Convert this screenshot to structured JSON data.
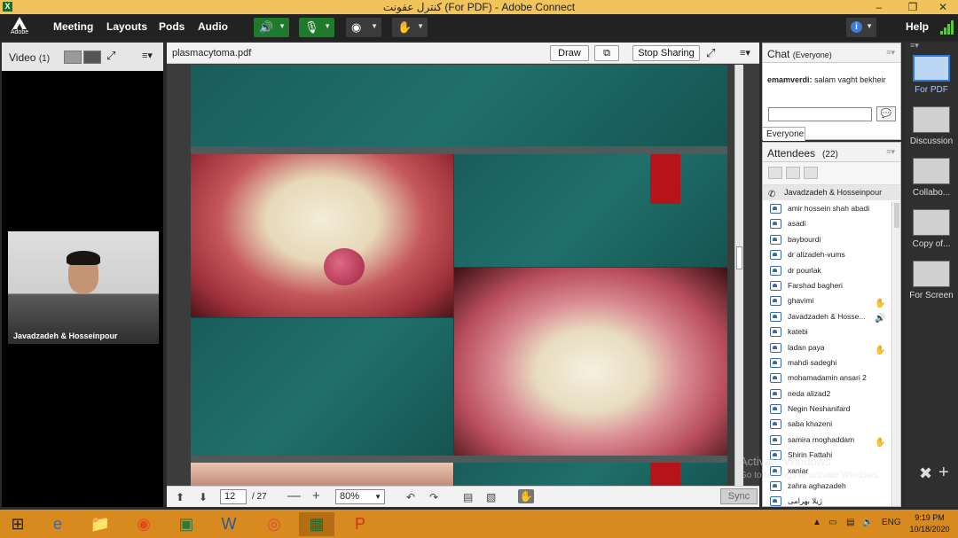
{
  "window": {
    "title": "کنترل عفونت (For PDF) - Adobe Connect",
    "logo_text": "Adobe"
  },
  "menubar": {
    "items": [
      "Meeting",
      "Layouts",
      "Pods",
      "Audio"
    ],
    "help_label": "Help",
    "speaker_state": "on",
    "mic_state": "muted"
  },
  "video_pod": {
    "title": "Video",
    "count": "(1)",
    "participant_name": "Javadzadeh & Hosseinpour"
  },
  "share_pod": {
    "filename": "plasmacytoma.pdf",
    "draw_label": "Draw",
    "stop_sharing_label": "Stop Sharing",
    "page_current": "12",
    "page_total": "/ 27",
    "zoom": "80%",
    "sync_label": "Sync"
  },
  "chat_pod": {
    "title": "Chat",
    "scope": "(Everyone)",
    "messages": [
      {
        "sender": "emamverdi:",
        "text": "salam vaght bekheir"
      }
    ],
    "recipient_tab": "Everyone"
  },
  "attendees_pod": {
    "title": "Attendees",
    "count": "(22)",
    "host": "Javadzadeh & Hosseinpour",
    "participants": [
      {
        "name": "amir hossein shah abadi",
        "status": ""
      },
      {
        "name": "asadi",
        "status": ""
      },
      {
        "name": "baybourdi",
        "status": ""
      },
      {
        "name": "dr alizadeh-vums",
        "status": ""
      },
      {
        "name": "dr pourlak",
        "status": ""
      },
      {
        "name": "Farshad bagheri",
        "status": ""
      },
      {
        "name": "ghavimi",
        "status": "raised-hand"
      },
      {
        "name": "Javadzadeh & Hosse...",
        "status": "speaking"
      },
      {
        "name": "katebi",
        "status": ""
      },
      {
        "name": "ladan paya",
        "status": "raised-hand"
      },
      {
        "name": "mahdi sadeghi",
        "status": ""
      },
      {
        "name": "mohamadamin ansari 2",
        "status": ""
      },
      {
        "name": "neda alizad2",
        "status": ""
      },
      {
        "name": "Negin Neshanifard",
        "status": ""
      },
      {
        "name": "saba khazeni",
        "status": ""
      },
      {
        "name": "samira moghaddam",
        "status": "raised-hand"
      },
      {
        "name": "Shirin Fattahi",
        "status": ""
      },
      {
        "name": "xaniar",
        "status": ""
      },
      {
        "name": "zahra aghazadeh",
        "status": ""
      },
      {
        "name": "ژیلا بهرامی",
        "status": ""
      }
    ]
  },
  "layouts_bar": {
    "items": [
      {
        "label": "For PDF",
        "active": true
      },
      {
        "label": "Discussion",
        "active": false
      },
      {
        "label": "Collabo...",
        "active": false
      },
      {
        "label": "Copy of...",
        "active": false
      },
      {
        "label": "For Screen",
        "active": false
      }
    ]
  },
  "watermark": {
    "line1": "Activate Windows",
    "line2": "Go to Settings to activate Windows."
  },
  "taskbar": {
    "language": "ENG",
    "time": "9:19 PM",
    "date": "10/18/2020"
  },
  "colors": {
    "menubar_bg": "#222222",
    "title_bg": "#f0c45a",
    "taskbar_bg": "#d98a1f",
    "accent_blue": "#2e7ad8",
    "slide_teal": "#1a5d5b",
    "slide_red": "#b5151a"
  }
}
